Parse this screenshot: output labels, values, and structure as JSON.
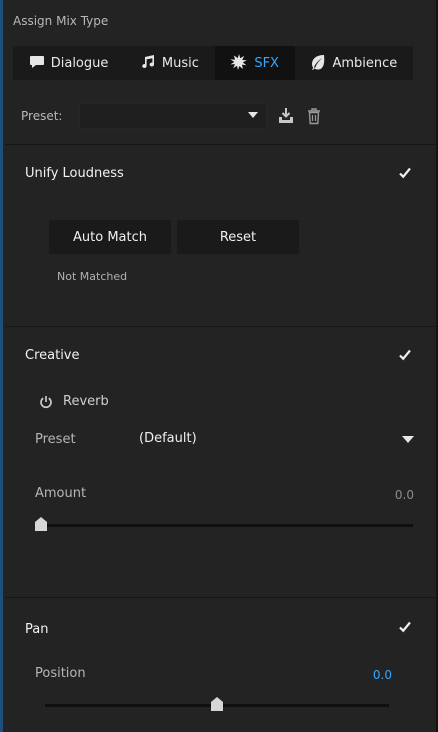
{
  "header": {
    "title": "Assign Mix Type"
  },
  "tabs": [
    {
      "label": "Dialogue",
      "icon": "speech-bubble-icon",
      "active": false
    },
    {
      "label": "Music",
      "icon": "music-note-icon",
      "active": false
    },
    {
      "label": "SFX",
      "icon": "burst-icon",
      "active": true
    },
    {
      "label": "Ambience",
      "icon": "leaf-icon",
      "active": false
    }
  ],
  "preset": {
    "label": "Preset:",
    "value": ""
  },
  "unify": {
    "title": "Unify Loudness",
    "checked": true,
    "auto_match_label": "Auto Match",
    "reset_label": "Reset",
    "status": "Not Matched"
  },
  "creative": {
    "title": "Creative",
    "checked": true,
    "reverb_label": "Reverb",
    "preset_label": "Preset",
    "preset_value": "(Default)",
    "amount_label": "Amount",
    "amount_value": "0.0",
    "amount_fraction": 0.0
  },
  "pan": {
    "title": "Pan",
    "checked": true,
    "position_label": "Position",
    "position_value": "0.0",
    "position_fraction": 0.5
  },
  "colors": {
    "background": "#232323",
    "accent_blue": "#35a7ff",
    "active_tab_bg": "#111111"
  }
}
